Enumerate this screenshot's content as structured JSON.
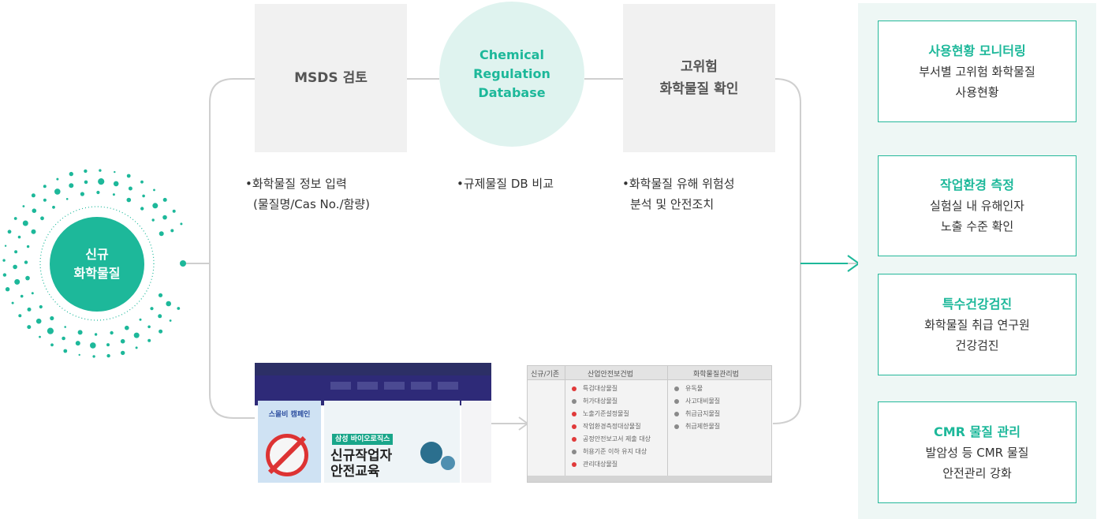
{
  "start": {
    "line1": "신규",
    "line2": "화학물질"
  },
  "steps": [
    {
      "lines": [
        "MSDS 검토"
      ],
      "desc": [
        "•화학물질 정보 입력",
        "(물질명/Cas No./함량)"
      ]
    },
    {
      "lines": [
        "Chemical",
        "Regulation",
        "Database"
      ],
      "desc": [
        "•규제물질 DB 비교"
      ]
    },
    {
      "lines": [
        "고위험",
        "화학물질 확인"
      ],
      "desc": [
        "•화학물질 유해 위험성",
        "분석 및 안전조치"
      ]
    }
  ],
  "monitoring": [
    {
      "title": "사용현황 모니터링",
      "lines": [
        "부서별 고위험 화학물질",
        "사용현황"
      ]
    },
    {
      "title": "작업환경 측정",
      "lines": [
        "실험실 내 유해인자",
        "노출 수준 확인"
      ]
    },
    {
      "title": "특수건강검진",
      "lines": [
        "화학물질 취급 연구원",
        "건강검진"
      ]
    },
    {
      "title": "CMR 물질 관리",
      "lines": [
        "발암성 등 CMR 물질",
        "안전관리 강화"
      ]
    }
  ],
  "screenshot_education": {
    "poster_title": "스몰비 캠페인",
    "tag": "삼성 바이오로직스",
    "title_line1": "신규작업자",
    "title_line2": "안전교육"
  },
  "screenshot_table": {
    "headers": [
      "신규/기존",
      "산업안전보건법",
      "화학물질관리법"
    ],
    "osha_items": [
      {
        "label": "특검대상물질",
        "status": "red"
      },
      {
        "label": "허가대상물질",
        "status": "grey"
      },
      {
        "label": "노출기준설정물질",
        "status": "red"
      },
      {
        "label": "작업환경측정대상물질",
        "status": "red"
      },
      {
        "label": "공정안전보고서 제출 대상",
        "status": "red"
      },
      {
        "label": "허용기준 이하 유지 대상",
        "status": "grey"
      },
      {
        "label": "관리대상물질",
        "status": "red"
      }
    ],
    "chem_items": [
      {
        "label": "유독물",
        "status": "grey"
      },
      {
        "label": "사고대비물질",
        "status": "grey"
      },
      {
        "label": "취급금지물질",
        "status": "grey"
      },
      {
        "label": "취급제한물질",
        "status": "grey"
      }
    ]
  },
  "colors": {
    "accent": "#1db89a",
    "panel": "#eef7f5",
    "box": "#f1f1f1",
    "line": "#cfcfcf"
  }
}
